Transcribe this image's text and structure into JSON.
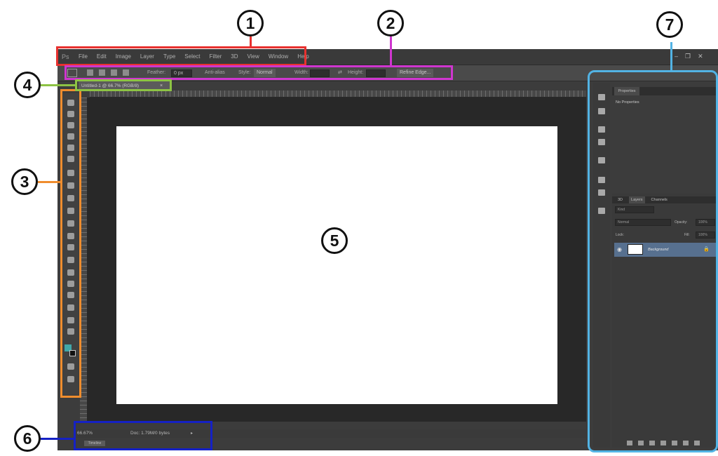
{
  "menu": {
    "logo": "Ps",
    "items": [
      "File",
      "Edit",
      "Image",
      "Layer",
      "Type",
      "Select",
      "Filter",
      "3D",
      "View",
      "Window",
      "Help"
    ]
  },
  "window_controls": {
    "minimize": "–",
    "restore": "❐",
    "close": "✕"
  },
  "options_bar": {
    "feather_label": "Feather:",
    "feather_value": "0 px",
    "anti_alias": "Anti-alias",
    "style_label": "Style:",
    "style_value": "Normal",
    "width_label": "Width:",
    "height_label": "Height:",
    "refine_edge": "Refine Edge..."
  },
  "document_tab": {
    "label": "Untitled-1 @ 66.7% (RGB/8)",
    "close": "×"
  },
  "status_bar": {
    "zoom": "66.67%",
    "doc_info": "Doc: 1.79M/0 bytes",
    "arrow": "▸",
    "timeline": "Timeline"
  },
  "properties_panel": {
    "tab": "Properties",
    "message": "No Properties"
  },
  "layers_panel": {
    "tabs": [
      "3D",
      "Layers",
      "Channels"
    ],
    "kind_label": "Kind",
    "blend_mode": "Normal",
    "opacity_label": "Opacity:",
    "opacity_value": "100%",
    "lock_label": "Lock:",
    "fill_label": "Fill:",
    "fill_value": "100%",
    "layers": [
      {
        "name": "Background",
        "visible": true,
        "locked": true
      }
    ]
  },
  "colors": {
    "foreground": "#41a7a9",
    "background": "#111111",
    "selected_layer": "#57708f"
  },
  "callouts": [
    "1",
    "2",
    "3",
    "4",
    "5",
    "6",
    "7"
  ]
}
